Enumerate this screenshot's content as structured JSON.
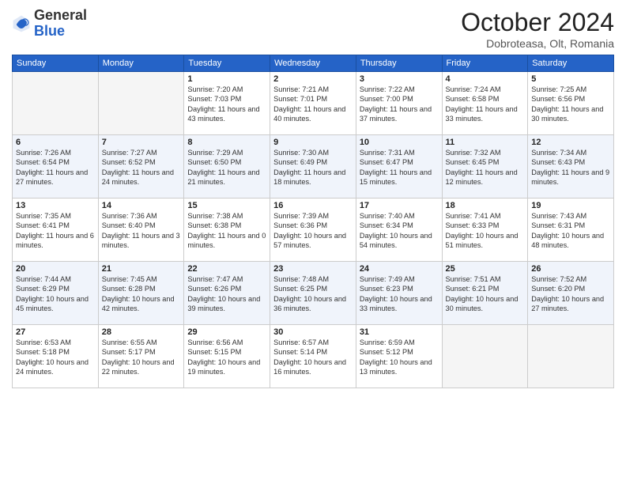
{
  "header": {
    "logo_general": "General",
    "logo_blue": "Blue",
    "month": "October 2024",
    "location": "Dobroteasa, Olt, Romania"
  },
  "days_of_week": [
    "Sunday",
    "Monday",
    "Tuesday",
    "Wednesday",
    "Thursday",
    "Friday",
    "Saturday"
  ],
  "weeks": [
    [
      {
        "num": "",
        "detail": ""
      },
      {
        "num": "",
        "detail": ""
      },
      {
        "num": "1",
        "detail": "Sunrise: 7:20 AM\nSunset: 7:03 PM\nDaylight: 11 hours and 43 minutes."
      },
      {
        "num": "2",
        "detail": "Sunrise: 7:21 AM\nSunset: 7:01 PM\nDaylight: 11 hours and 40 minutes."
      },
      {
        "num": "3",
        "detail": "Sunrise: 7:22 AM\nSunset: 7:00 PM\nDaylight: 11 hours and 37 minutes."
      },
      {
        "num": "4",
        "detail": "Sunrise: 7:24 AM\nSunset: 6:58 PM\nDaylight: 11 hours and 33 minutes."
      },
      {
        "num": "5",
        "detail": "Sunrise: 7:25 AM\nSunset: 6:56 PM\nDaylight: 11 hours and 30 minutes."
      }
    ],
    [
      {
        "num": "6",
        "detail": "Sunrise: 7:26 AM\nSunset: 6:54 PM\nDaylight: 11 hours and 27 minutes."
      },
      {
        "num": "7",
        "detail": "Sunrise: 7:27 AM\nSunset: 6:52 PM\nDaylight: 11 hours and 24 minutes."
      },
      {
        "num": "8",
        "detail": "Sunrise: 7:29 AM\nSunset: 6:50 PM\nDaylight: 11 hours and 21 minutes."
      },
      {
        "num": "9",
        "detail": "Sunrise: 7:30 AM\nSunset: 6:49 PM\nDaylight: 11 hours and 18 minutes."
      },
      {
        "num": "10",
        "detail": "Sunrise: 7:31 AM\nSunset: 6:47 PM\nDaylight: 11 hours and 15 minutes."
      },
      {
        "num": "11",
        "detail": "Sunrise: 7:32 AM\nSunset: 6:45 PM\nDaylight: 11 hours and 12 minutes."
      },
      {
        "num": "12",
        "detail": "Sunrise: 7:34 AM\nSunset: 6:43 PM\nDaylight: 11 hours and 9 minutes."
      }
    ],
    [
      {
        "num": "13",
        "detail": "Sunrise: 7:35 AM\nSunset: 6:41 PM\nDaylight: 11 hours and 6 minutes."
      },
      {
        "num": "14",
        "detail": "Sunrise: 7:36 AM\nSunset: 6:40 PM\nDaylight: 11 hours and 3 minutes."
      },
      {
        "num": "15",
        "detail": "Sunrise: 7:38 AM\nSunset: 6:38 PM\nDaylight: 11 hours and 0 minutes."
      },
      {
        "num": "16",
        "detail": "Sunrise: 7:39 AM\nSunset: 6:36 PM\nDaylight: 10 hours and 57 minutes."
      },
      {
        "num": "17",
        "detail": "Sunrise: 7:40 AM\nSunset: 6:34 PM\nDaylight: 10 hours and 54 minutes."
      },
      {
        "num": "18",
        "detail": "Sunrise: 7:41 AM\nSunset: 6:33 PM\nDaylight: 10 hours and 51 minutes."
      },
      {
        "num": "19",
        "detail": "Sunrise: 7:43 AM\nSunset: 6:31 PM\nDaylight: 10 hours and 48 minutes."
      }
    ],
    [
      {
        "num": "20",
        "detail": "Sunrise: 7:44 AM\nSunset: 6:29 PM\nDaylight: 10 hours and 45 minutes."
      },
      {
        "num": "21",
        "detail": "Sunrise: 7:45 AM\nSunset: 6:28 PM\nDaylight: 10 hours and 42 minutes."
      },
      {
        "num": "22",
        "detail": "Sunrise: 7:47 AM\nSunset: 6:26 PM\nDaylight: 10 hours and 39 minutes."
      },
      {
        "num": "23",
        "detail": "Sunrise: 7:48 AM\nSunset: 6:25 PM\nDaylight: 10 hours and 36 minutes."
      },
      {
        "num": "24",
        "detail": "Sunrise: 7:49 AM\nSunset: 6:23 PM\nDaylight: 10 hours and 33 minutes."
      },
      {
        "num": "25",
        "detail": "Sunrise: 7:51 AM\nSunset: 6:21 PM\nDaylight: 10 hours and 30 minutes."
      },
      {
        "num": "26",
        "detail": "Sunrise: 7:52 AM\nSunset: 6:20 PM\nDaylight: 10 hours and 27 minutes."
      }
    ],
    [
      {
        "num": "27",
        "detail": "Sunrise: 6:53 AM\nSunset: 5:18 PM\nDaylight: 10 hours and 24 minutes."
      },
      {
        "num": "28",
        "detail": "Sunrise: 6:55 AM\nSunset: 5:17 PM\nDaylight: 10 hours and 22 minutes."
      },
      {
        "num": "29",
        "detail": "Sunrise: 6:56 AM\nSunset: 5:15 PM\nDaylight: 10 hours and 19 minutes."
      },
      {
        "num": "30",
        "detail": "Sunrise: 6:57 AM\nSunset: 5:14 PM\nDaylight: 10 hours and 16 minutes."
      },
      {
        "num": "31",
        "detail": "Sunrise: 6:59 AM\nSunset: 5:12 PM\nDaylight: 10 hours and 13 minutes."
      },
      {
        "num": "",
        "detail": ""
      },
      {
        "num": "",
        "detail": ""
      }
    ]
  ]
}
